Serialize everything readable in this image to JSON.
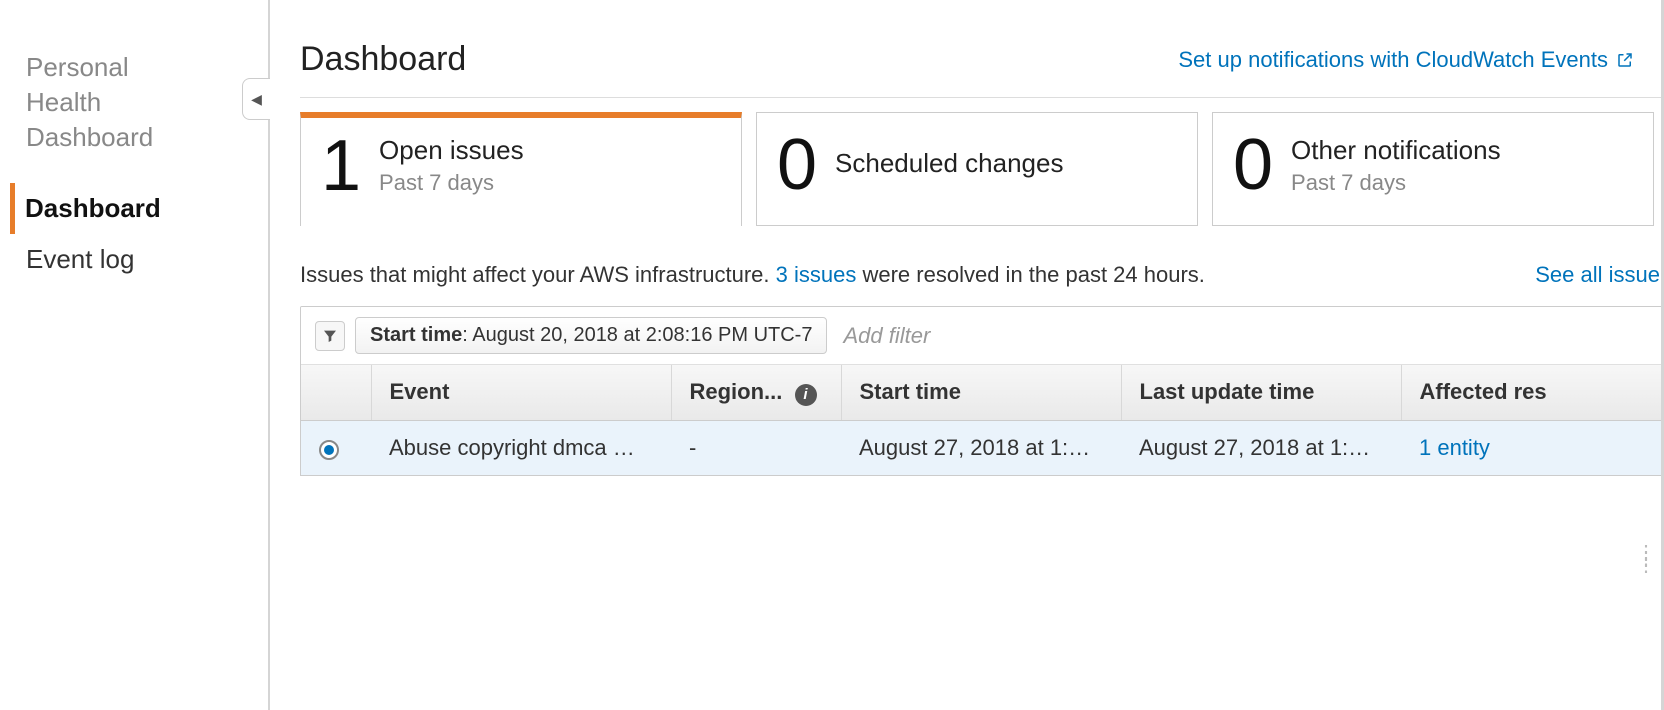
{
  "sidebar": {
    "title_line1": "Personal",
    "title_line2": "Health",
    "title_line3": "Dashboard",
    "items": [
      {
        "label": "Dashboard",
        "active": true
      },
      {
        "label": "Event log",
        "active": false
      }
    ],
    "collapse_glyph": "◀"
  },
  "header": {
    "title": "Dashboard",
    "notif_link": "Set up notifications with CloudWatch Events"
  },
  "cards": [
    {
      "count": "1",
      "title": "Open issues",
      "sub": "Past 7 days",
      "active": true
    },
    {
      "count": "0",
      "title": "Scheduled changes",
      "sub": "",
      "active": false
    },
    {
      "count": "0",
      "title": "Other notifications",
      "sub": "Past 7 days",
      "active": false
    }
  ],
  "issues_line": {
    "prefix": "Issues that might affect your AWS infrastructure. ",
    "resolved_link": "3 issues",
    "suffix": " were resolved in the past 24 hours.",
    "see_all": "See all issue"
  },
  "filter": {
    "chip_label": "Start time",
    "chip_value": ": August 20, 2018 at 2:08:16 PM UTC-7",
    "add_filter": "Add filter"
  },
  "table": {
    "columns": {
      "c0": "",
      "c1": "Event",
      "c2": "Region...",
      "c3": "Start time",
      "c4": "Last update time",
      "c5": "Affected res"
    },
    "rows": [
      {
        "event": "Abuse copyright dmca …",
        "region": "-",
        "start": "August 27, 2018 at 1:…",
        "updated": "August 27, 2018 at 1:…",
        "affected": "1 entity",
        "selected": true
      }
    ]
  }
}
